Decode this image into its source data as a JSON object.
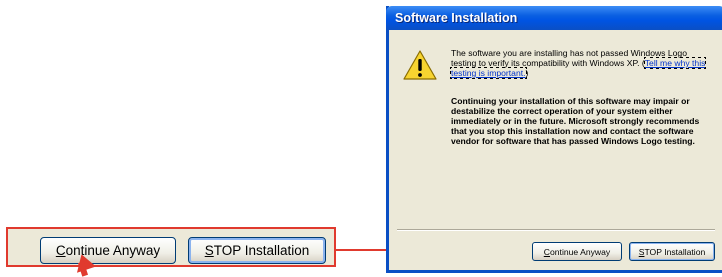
{
  "dialog": {
    "title": "Software Installation",
    "message_pre": "The software you are installing has not passed Windows Logo testing to verify its compatibility with Windows XP. (",
    "message_link": "Tell me why this testing is important.",
    "message_post": ")",
    "warning": "Continuing your installation of this software may impair or destabilize the correct operation of your system either immediately or in the future. Microsoft strongly recommends that you stop this installation now and contact the software vendor for software that has passed Windows Logo testing.",
    "icon": "warning-icon",
    "continue_mnemonic": "C",
    "continue_rest": "ontinue Anyway",
    "stop_mnemonic": "S",
    "stop_rest": "TOP Installation"
  },
  "callout": {
    "continue_mnemonic": "C",
    "continue_rest": "ontinue Anyway",
    "stop_mnemonic": "S",
    "stop_rest": "TOP Installation"
  },
  "colors": {
    "highlight": "#e03a2e",
    "titlebar": "#0054e3",
    "dialog_bg": "#ece9d8"
  }
}
